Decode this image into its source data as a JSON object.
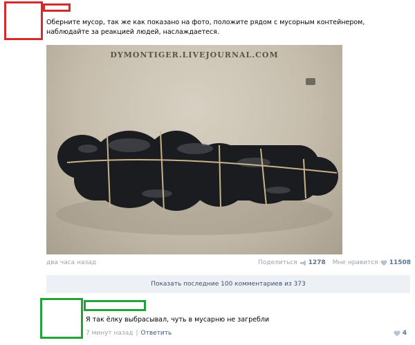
{
  "post": {
    "text": "Оберните мусор, так же как показано на фото, положите рядом с мусорным контейнером, наблюдайте за реакцией людей, наслаждаетеся.",
    "photo_watermark": "DYMONTIGER.LIVEJOURNAL.COM",
    "time": "два часа назад",
    "share_label": "Поделиться",
    "share_count": "1278",
    "like_label": "Мне нравится",
    "like_count": "11508",
    "show_comments_label": "Показать последние 100 комментариев из 373"
  },
  "comment": {
    "text": "Я так ёлку выбрасывал, чуть в мусарню не загребли",
    "time": "7 минут назад",
    "separator": "|",
    "reply_label": "Ответить",
    "like_count": "4"
  },
  "colors": {
    "redaction_red": "#d62b2b",
    "redaction_green": "#22a33a",
    "link_blue": "#3c5a80",
    "muted_gray": "#9aa4ae",
    "panel_bg": "#edf1f5"
  },
  "icons": {
    "share": "megaphone-icon",
    "like": "heart-icon"
  }
}
